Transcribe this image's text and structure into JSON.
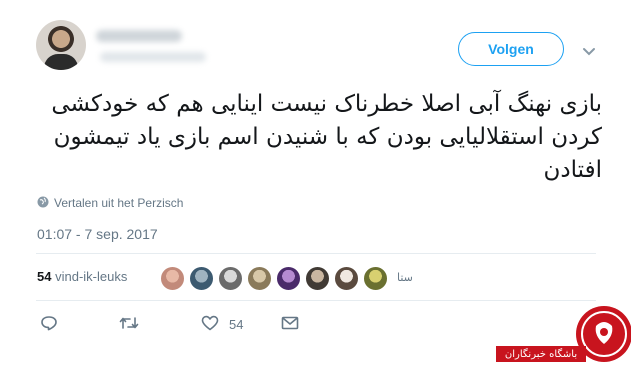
{
  "header": {
    "follow_label": "Volgen"
  },
  "tweet": {
    "text": "بازی نهنگ آبی اصلا خطرناک نیست اینایی هم که خودکشی کردن استقلالیایی بودن که با شنیدن اسم بازی یاد تیمشون افتادن",
    "translate_label": "Vertalen uit het Perzisch",
    "timestamp": "01:07 - 7 sep. 2017"
  },
  "likes": {
    "count": "54",
    "label": "vind-ik-leuks",
    "last_liker": "ستا"
  },
  "actions": {
    "like_count": "54"
  },
  "watermark": {
    "label": "باشگاه خبرنگاران",
    "color": "#c8141e"
  },
  "colors": {
    "accent": "#1da1f2",
    "muted": "#657786"
  },
  "icons": [
    "globe-icon",
    "reply-icon",
    "retweet-icon",
    "heart-icon",
    "envelope-icon",
    "chevron-down-icon"
  ]
}
